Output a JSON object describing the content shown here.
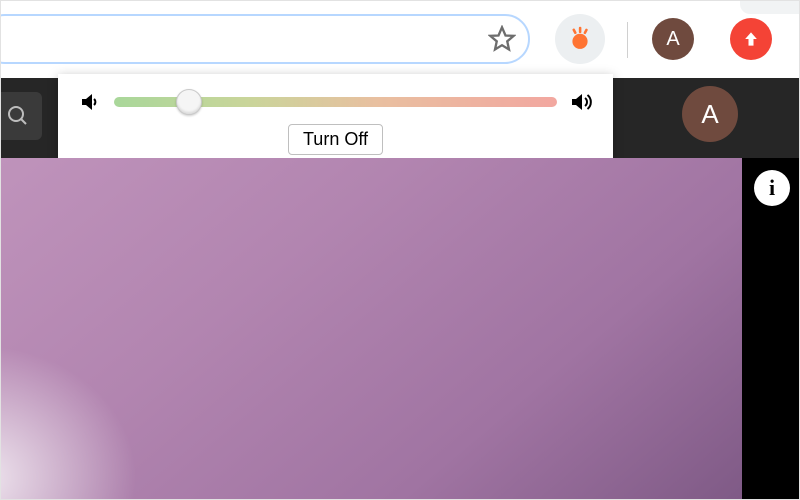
{
  "toolbar": {
    "avatar_initial": "A",
    "ext_icon": "volume-extension"
  },
  "popup": {
    "turn_off_label": "Turn Off",
    "slider_value_pct": 17
  },
  "appbar": {
    "avatar_initial": "A"
  },
  "info_button_label": "i"
}
